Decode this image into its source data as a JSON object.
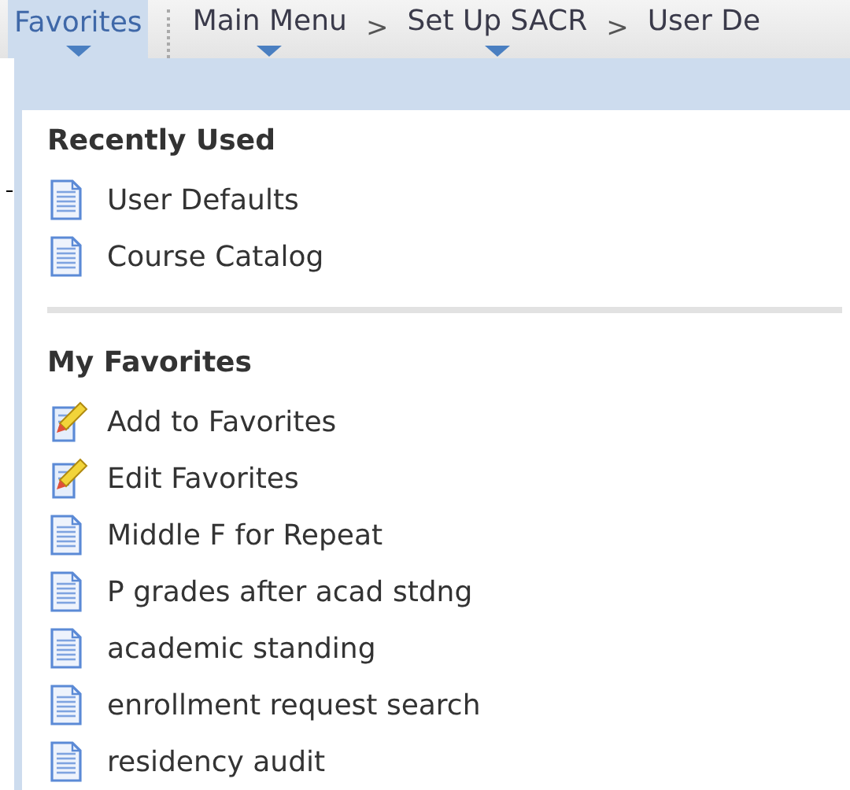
{
  "nav": [
    {
      "kind": "tab",
      "label": "Favorites",
      "selected": true,
      "dropdown": true
    },
    {
      "kind": "link",
      "label": "Main Menu",
      "selected": false,
      "dropdown": true
    },
    {
      "kind": "sep",
      "label": ">"
    },
    {
      "kind": "link",
      "label": "Set Up SACR",
      "selected": false,
      "dropdown": true
    },
    {
      "kind": "sep",
      "label": ">"
    },
    {
      "kind": "link",
      "label": "User De",
      "selected": false,
      "dropdown": false
    }
  ],
  "sections": [
    {
      "title": "Recently Used",
      "items": [
        {
          "kind": "page",
          "label": "User Defaults"
        },
        {
          "kind": "page",
          "label": "Course Catalog"
        }
      ]
    },
    {
      "title": "My Favorites",
      "items": [
        {
          "kind": "edit",
          "label": "Add to Favorites"
        },
        {
          "kind": "edit",
          "label": "Edit Favorites"
        },
        {
          "kind": "page",
          "label": "Middle F for Repeat"
        },
        {
          "kind": "page",
          "label": "P grades after acad stdng"
        },
        {
          "kind": "page",
          "label": "academic standing"
        },
        {
          "kind": "page",
          "label": "enrollment request search"
        },
        {
          "kind": "page",
          "label": "residency audit"
        }
      ]
    }
  ]
}
